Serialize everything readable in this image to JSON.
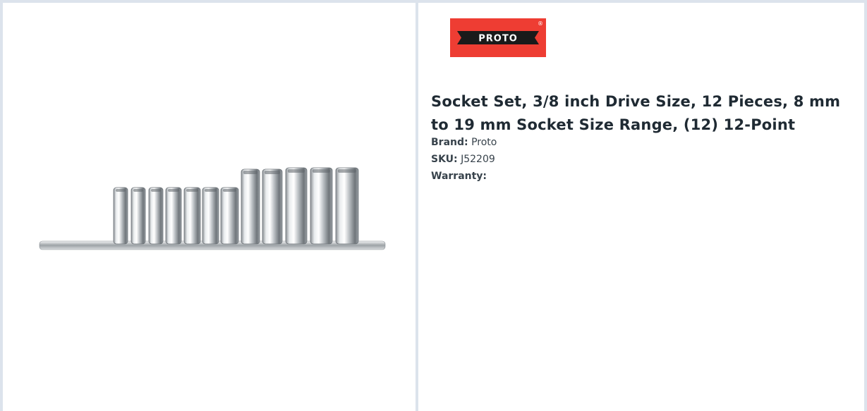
{
  "brand_logo": {
    "text": "PROTO",
    "mark": "®",
    "color": "#ee3d33"
  },
  "product": {
    "title": "Socket Set, 3/8 inch Drive Size, 12 Pieces, 8 mm to 19 mm Socket Size Range, (12) 12-Point",
    "image_alt": "socket-set-on-rail",
    "specs": [
      {
        "label": "Brand:",
        "value": "Proto"
      },
      {
        "label": "SKU:",
        "value": "J52209"
      },
      {
        "label": "Warranty:",
        "value": ""
      }
    ]
  },
  "colors": {
    "border": "#dce3ec",
    "title": "#1f2a33",
    "text": "#37424b"
  }
}
